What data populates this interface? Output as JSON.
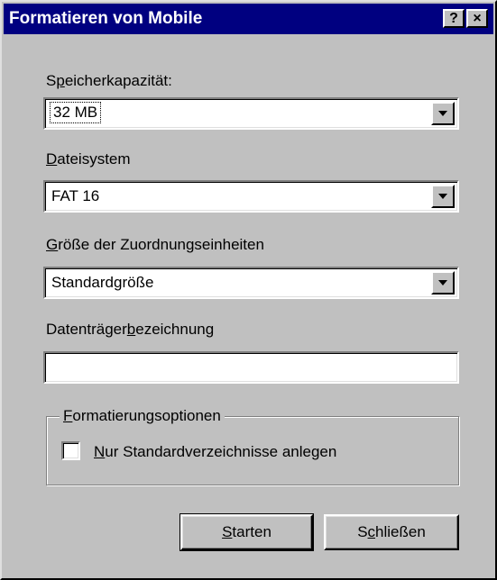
{
  "window": {
    "title": "Formatieren von Mobile",
    "help_button": "?",
    "close_button": "×"
  },
  "capacity": {
    "label_pre": "S",
    "label_key": "p",
    "label_post": "eicherkapazität:",
    "value": "32 MB"
  },
  "filesystem": {
    "label_key": "D",
    "label_post": "ateisystem",
    "value": "FAT 16"
  },
  "allocation": {
    "label_key": "G",
    "label_post": "röße der Zuordnungseinheiten",
    "value": "Standardgröße"
  },
  "volume_label": {
    "label_pre": "Datenträger",
    "label_key": "b",
    "label_post": "ezeichnung",
    "value": ""
  },
  "options": {
    "legend_key": "F",
    "legend_post": "ormatierungsoptionen",
    "checkbox_key": "N",
    "checkbox_post": "ur Standardverzeichnisse anlegen",
    "checked": false
  },
  "buttons": {
    "start_key": "S",
    "start_post": "tarten",
    "close_pre": "S",
    "close_key": "c",
    "close_post": "hließen"
  }
}
